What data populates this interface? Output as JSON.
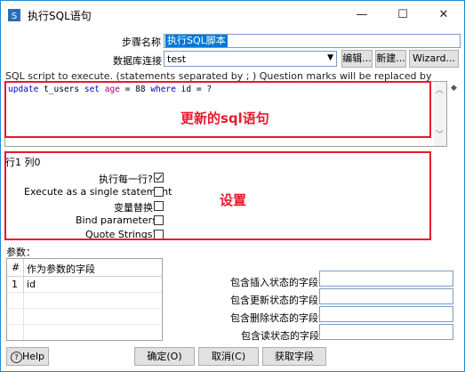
{
  "window": {
    "title": "执行SQL语句",
    "minimize": "—",
    "maximize": "☐",
    "close": "✕"
  },
  "form": {
    "step_name_label": "步骤名称",
    "step_name_value": "执行SQL脚本",
    "connection_label": "数据库连接",
    "connection_value": "test",
    "edit_btn": "编辑...",
    "new_btn": "新建...",
    "wizard_btn": "Wizard...",
    "script_hint": "SQL script to execute. (statements separated by ; ) Question marks will be replaced by arguments."
  },
  "sql": {
    "kw1": "update",
    "table": "t_users",
    "kw2": "set",
    "col1": "age",
    "eq1": "=",
    "num": "88",
    "kw3": "where",
    "col2": "id",
    "eq2": "=",
    "param": "?"
  },
  "annotations": {
    "sql_note": "更新的sql语句",
    "settings_note": "设置"
  },
  "position_text": "行1 列0",
  "options": [
    {
      "label": "执行每一行?",
      "checked": true
    },
    {
      "label": "Execute as a single statement",
      "checked": false
    },
    {
      "label": "变量替换",
      "checked": false
    },
    {
      "label": "Bind parameters?",
      "checked": false
    },
    {
      "label": "Quote Strings?",
      "checked": false
    }
  ],
  "params": {
    "label": "参数：",
    "col_num": "#",
    "col_field": "作为参数的字段",
    "rows": [
      {
        "num": "1",
        "field": "id"
      }
    ]
  },
  "status_fields": [
    {
      "label": "包含插入状态的字段",
      "value": ""
    },
    {
      "label": "包含更新状态的字段",
      "value": ""
    },
    {
      "label": "包含删除状态的字段",
      "value": ""
    },
    {
      "label": "包含读状态的字段",
      "value": ""
    }
  ],
  "buttons": {
    "help": "Help",
    "ok": "确定(O)",
    "cancel": "取消(C)",
    "get_fields": "获取字段"
  },
  "colors": {
    "accent": "#1f8ad6",
    "annotation": "#e8192c",
    "sql_keyword": "#0000c0",
    "sql_field": "#9a0089"
  }
}
